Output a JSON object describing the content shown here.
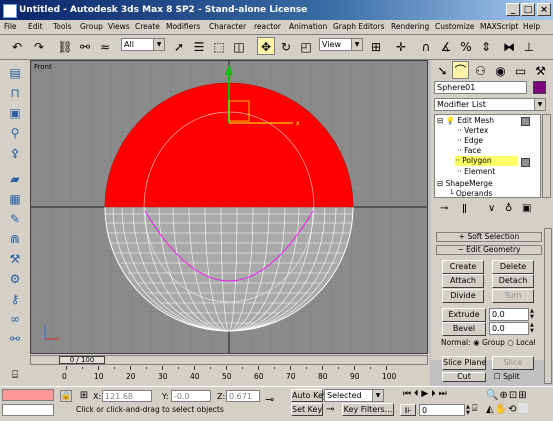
{
  "window": {
    "title": "Untitled - Autodesk 3ds Max 8 SP2 - Stand-alone License",
    "min": "_",
    "max": "□",
    "close": "×"
  },
  "menu": [
    "File",
    "Edit",
    "Tools",
    "Group",
    "Views",
    "Create",
    "Modifiers",
    "Character",
    "reactor",
    "Animation",
    "Graph Editors",
    "Rendering",
    "Customize",
    "MAXScript",
    "Help"
  ],
  "toolbar": {
    "selection_filter": "All",
    "ref_coord": "View"
  },
  "viewport": {
    "label": "Front",
    "colors": {
      "selected_poly": "#ff0000",
      "wire": "#ffffff",
      "bg": "#8b8b8b",
      "gizmo": "#ff00ff"
    }
  },
  "command_panel": {
    "object_name": "Sphere01",
    "object_color": "#800080",
    "modifier_list": "Modifier List",
    "stack": [
      {
        "label": "Edit Mesh",
        "level": 0
      },
      {
        "label": "Vertex",
        "level": 1
      },
      {
        "label": "Edge",
        "level": 1
      },
      {
        "label": "Face",
        "level": 1
      },
      {
        "label": "Polygon",
        "level": 1,
        "selected": true
      },
      {
        "label": "Element",
        "level": 1
      },
      {
        "label": "ShapeMerge",
        "level": 0
      },
      {
        "label": "Operands",
        "level": 1
      }
    ],
    "soft_selection": "Soft Selection",
    "edit_geometry": "Edit Geometry",
    "buttons": {
      "create": "Create",
      "delete": "Delete",
      "attach": "Attach",
      "detach": "Detach",
      "divide": "Divide",
      "turn": "Turn",
      "extrude": "Extrude",
      "bevel": "Bevel",
      "slice_plane": "Slice Plane",
      "slice": "Slice",
      "cut": "Cut",
      "split": "Split"
    },
    "extrude_value": "0.0",
    "bevel_value": "0.0",
    "normal_label": "Normal:",
    "normal_group": "Group",
    "normal_local": "Local"
  },
  "timeline": {
    "slider": "0 / 100",
    "ticks": [
      "0",
      "10",
      "20",
      "30",
      "40",
      "50",
      "60",
      "70",
      "80",
      "90",
      "100"
    ]
  },
  "status": {
    "x_label": "X:",
    "x_value": "121.68",
    "y_label": "Y:",
    "y_value": "-0.0",
    "z_label": "Z:",
    "z_value": "0.671",
    "prompt": "Click or click-and-drag to select objects",
    "auto_key": "Auto Key",
    "set_key": "Set Key",
    "key_mode": "Selected",
    "key_filters": "Key Filters...",
    "frame": "0"
  }
}
